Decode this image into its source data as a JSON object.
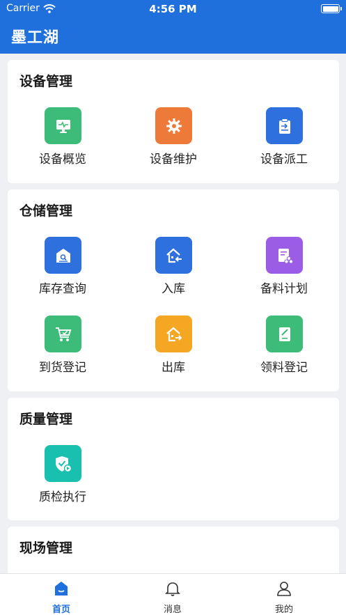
{
  "status_bar": {
    "carrier": "Carrier",
    "time": "4:56 PM"
  },
  "header": {
    "title": "墨工湖"
  },
  "sections": {
    "equipment": {
      "title": "设备管理",
      "items": [
        {
          "label": "设备概览",
          "icon": "monitor-icon",
          "color": "#3dbb78"
        },
        {
          "label": "设备维护",
          "icon": "gear-icon",
          "color": "#ee7a3a"
        },
        {
          "label": "设备派工",
          "icon": "clipboard-icon",
          "color": "#2e70dd"
        }
      ]
    },
    "warehouse": {
      "title": "仓储管理",
      "items": [
        {
          "label": "库存查询",
          "icon": "warehouse-search-icon",
          "color": "#2e70dd"
        },
        {
          "label": "入库",
          "icon": "house-in-icon",
          "color": "#2e70dd"
        },
        {
          "label": "备料计划",
          "icon": "plan-icon",
          "color": "#9b5de5"
        },
        {
          "label": "到货登记",
          "icon": "cart-icon",
          "color": "#3dbb78"
        },
        {
          "label": "出库",
          "icon": "house-out-icon",
          "color": "#f5a623"
        },
        {
          "label": "领料登记",
          "icon": "note-icon",
          "color": "#3dbb78"
        }
      ]
    },
    "quality": {
      "title": "质量管理",
      "items": [
        {
          "label": "质检执行",
          "icon": "shield-check-icon",
          "color": "#19c0b0"
        }
      ]
    },
    "site": {
      "title": "现场管理"
    }
  },
  "tabbar": {
    "items": [
      {
        "label": "首页",
        "icon": "home-icon",
        "active": true
      },
      {
        "label": "消息",
        "icon": "bell-icon",
        "active": false
      },
      {
        "label": "我的",
        "icon": "user-icon",
        "active": false
      }
    ]
  }
}
